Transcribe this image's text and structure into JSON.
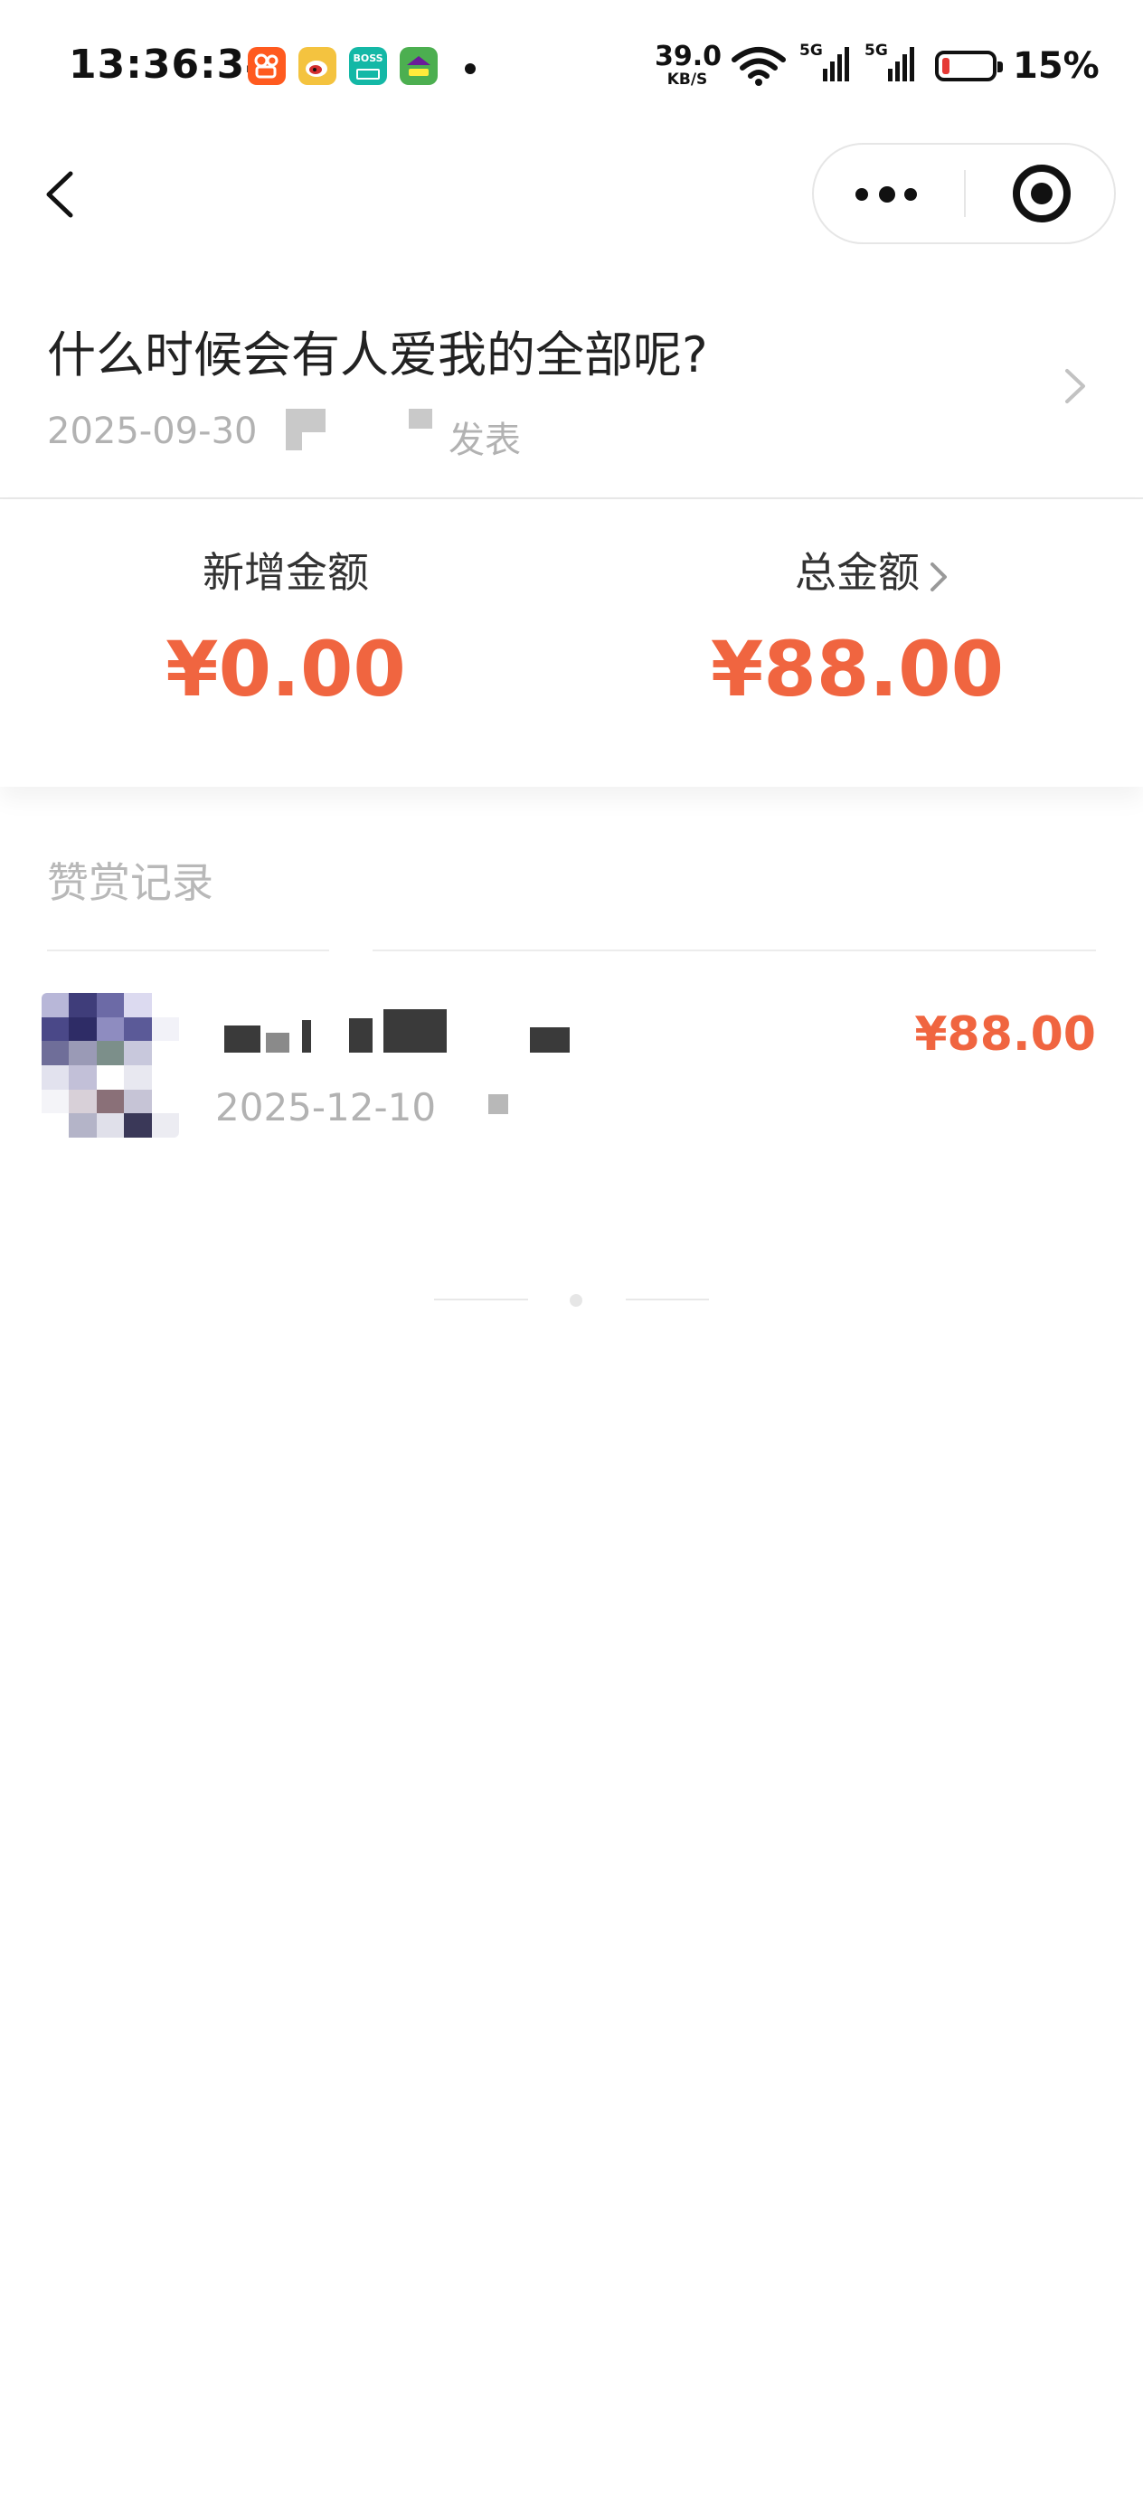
{
  "status_bar": {
    "time": "13:36:34",
    "net_speed_value": "39.0",
    "net_speed_unit": "KB/S",
    "signal1_label": "5G",
    "signal2_label": "5G",
    "battery_percent": "15%",
    "battery_level": 0.15,
    "apps": [
      {
        "icon": "kuaishou-icon",
        "color": "#ff5a1f"
      },
      {
        "icon": "weibo-icon",
        "color": "#f4c33f"
      },
      {
        "icon": "boss-zhipin-icon",
        "color": "#14b8a6",
        "text": "BOSS"
      },
      {
        "icon": "game-app-icon",
        "color": "#4caf50"
      }
    ]
  },
  "nav": {
    "back_icon": "back-chevron-icon",
    "more_icon": "more-dots-icon",
    "close_icon": "target-circle-icon"
  },
  "article": {
    "title": "什么时候会有人爱我的全部呢?",
    "date": "2025-09-30",
    "published_label": "发表"
  },
  "stats": {
    "new_amount_label": "新增金额",
    "new_amount_value": "¥0.00",
    "total_amount_label": "总金额",
    "total_amount_value": "¥88.00",
    "accent_color": "#f06540"
  },
  "records": {
    "title": "赞赏记录",
    "items": [
      {
        "date": "2025-12-10",
        "amount": "¥88.00"
      }
    ]
  }
}
